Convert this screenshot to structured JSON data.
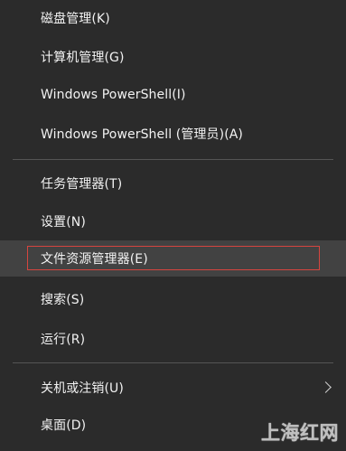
{
  "menu": {
    "items": [
      {
        "label": "磁盘管理(K)"
      },
      {
        "label": "计算机管理(G)"
      },
      {
        "label": "Windows PowerShell(I)"
      },
      {
        "label": "Windows PowerShell (管理员)(A)"
      },
      {
        "label": "任务管理器(T)"
      },
      {
        "label": "设置(N)"
      },
      {
        "label": "文件资源管理器(E)"
      },
      {
        "label": "搜索(S)"
      },
      {
        "label": "运行(R)"
      },
      {
        "label": "关机或注销(U)"
      },
      {
        "label": "桌面(D)"
      }
    ],
    "chevron_icon": "chevron-right-icon"
  },
  "colors": {
    "background": "#2b2b2b",
    "text": "#f2f2f2",
    "hover": "#424242",
    "highlight_border": "#d6453f",
    "separator": "#555555"
  },
  "watermark": {
    "text": "上海红网"
  }
}
